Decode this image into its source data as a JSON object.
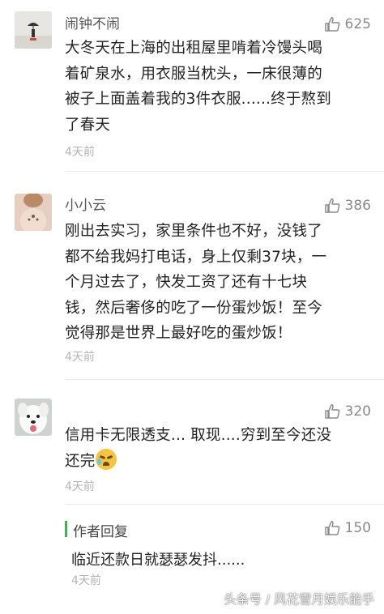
{
  "comments": [
    {
      "name": "闹钟不闹",
      "likes": "625",
      "lines": [
        "大冬天在上海的出租屋里啃着冷馒头喝",
        "着矿泉水，用衣服当枕头，一床很薄的",
        "被子上面盖着我的3件衣服......终于熬到",
        "了春天"
      ],
      "time": "4天前",
      "avatar_icon": "person-with-umbrella-beach-avatar"
    },
    {
      "name": "小小云",
      "likes": "386",
      "lines": [
        "刚出去实习，家里条件也不好，没钱了",
        "都不给我妈打电话，身上仅剩37块，一",
        "个月过去了，快发工资了还有十七块",
        "钱，然后奢侈的吃了一份蛋炒饭！至今",
        "觉得那是世界上最好吃的蛋炒饭！"
      ],
      "time": "4天前",
      "avatar_icon": "tattooed-back-avatar"
    },
    {
      "name": "",
      "likes": "320",
      "lines": [
        "信用卡无限透支... 取现....穷到至今还没",
        "还完"
      ],
      "time": "4天前",
      "avatar_icon": "white-dog-avatar"
    }
  ],
  "author_reply": {
    "title": "作者回复",
    "likes": "150",
    "text": "临近还款日就瑟瑟发抖......",
    "time": "4天前"
  },
  "watermark": "头条号 / 风花雪月娱乐能手",
  "colors": {
    "reply_accent": "#3fb34f",
    "muted": "#b5b5b5"
  }
}
